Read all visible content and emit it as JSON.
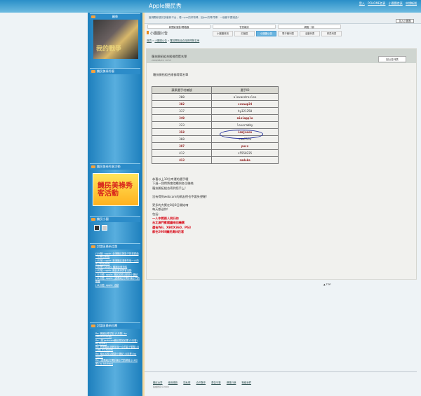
{
  "site": {
    "title": "Apple饑民秀",
    "top_links": [
      "登入",
      "PCHOME首頁",
      "小團團首頁",
      "申請帳號"
    ],
    "description": "當佛飄軟香的多動新平台，看一pm的好物棒，回pm的哥們棒！一個都不要錯過!",
    "subscribe_label": "加入小團團",
    "marquee_tabs": [
      "新聞影運動!開箱趣",
      "會員雜誌",
      "網路一樣!"
    ]
  },
  "sidebar": {
    "profile_label": "圖像",
    "avatar_caption": "我的戰爭",
    "section1": "饑民美祿秀客",
    "section2": "饑民美祿秀客活動",
    "section3": "饑民小團",
    "section4": "討論區最新話題",
    "discussion_items": [
      "(5/4發) apple: 全港饑民與影子的邀請函一的飯店觀點",
      "(4月發) apple: 首港饑民漫數年後一小的影子觀點預覽",
      "(9月發) saqlin: 饑國反應資料",
      "(9月發) apple: 饑民美祿秀客活動",
      "(11月發) apple: 饑民抽獎活動新小團紀",
      "(11月發) apple: [遊戲組]打開手機小門的鮮客",
      "(11月發) apple: 活動"
    ],
    "section5": "討論區最新回覆",
    "reply_items": [
      "Re: 饑國反應項目 (3月發) by stevenchang)",
      "Re: [獎]webcam饑民是如影響 (5月發) by apple)",
      "Re: 首發饑民漫數年後一小的影子觀點 (4月發) by apple)",
      "Re: 饑民抽獎活動新小團紀 (4月發) by apple)",
      "Re: [遊戲組]打開手機小門的鮮客 (11月發) by bitzhen)"
    ]
  },
  "board": {
    "name": "小團團公告",
    "tabs": [
      "小團團資訊",
      "討論區",
      "小團團公告",
      "電子報列表",
      "活動列表",
      "會員列表"
    ],
    "active_tab": 2
  },
  "breadcrumb": [
    "首頁",
    "小團團公告",
    "羅技開拓組合搖佛得獎名單"
  ],
  "post": {
    "title": "羅技開拓組合搖佛得獎名單",
    "date": "2009/08/03, 10:55",
    "back_label": "回公告列表",
    "lead": "羅技開拓組合搖佛得獎名單",
    "table_headers": [
      "蘋果選手村編號",
      "選手ID"
    ],
    "rows": [
      {
        "no": "200",
        "id": "alexandroslee",
        "hl": false
      },
      {
        "no": "302",
        "id": "ccxawp34",
        "hl": true
      },
      {
        "no": "337",
        "id": "hy321250",
        "hl": false
      },
      {
        "no": "349",
        "id": "miniapple",
        "hl": true
      },
      {
        "no": "223",
        "id": "loverabby",
        "hl": false
      },
      {
        "no": "358",
        "id": "iamjason",
        "hl": true
      },
      {
        "no": "360",
        "id": "cow7570",
        "hl": false
      },
      {
        "no": "397",
        "id": "pucs",
        "hl": true
      },
      {
        "no": "412",
        "id": "s5558235",
        "hl": false
      },
      {
        "no": "413",
        "id": "nadoka",
        "hl": true
      }
    ],
    "para1": [
      "恭喜以上10位幸運的選手喔",
      "下週一我們將會陸續與各位聯絡",
      "羅技開拓組合寄到您手上!"
    ],
    "para2": "沒有得到webcam的網友們也不要失望喔!",
    "para3": [
      "更多的大獎在8月8日開始唷",
      "每天都送你!",
      "包括:"
    ],
    "red_lines": [
      "一人中獎兩人同行的",
      "台北澳門賓館廳來回機票",
      "還有Wii、XBOX360、PS3",
      "都在2008饑民奧林匹客"
    ],
    "top_label": "TOP"
  },
  "footer": {
    "links": [
      "饑民台秀",
      "使用條款",
      "隱私權",
      "合作夥伴",
      "廣告刊登",
      "網路行銷",
      "聯絡我們"
    ],
    "copy": "版權所有©2009"
  }
}
